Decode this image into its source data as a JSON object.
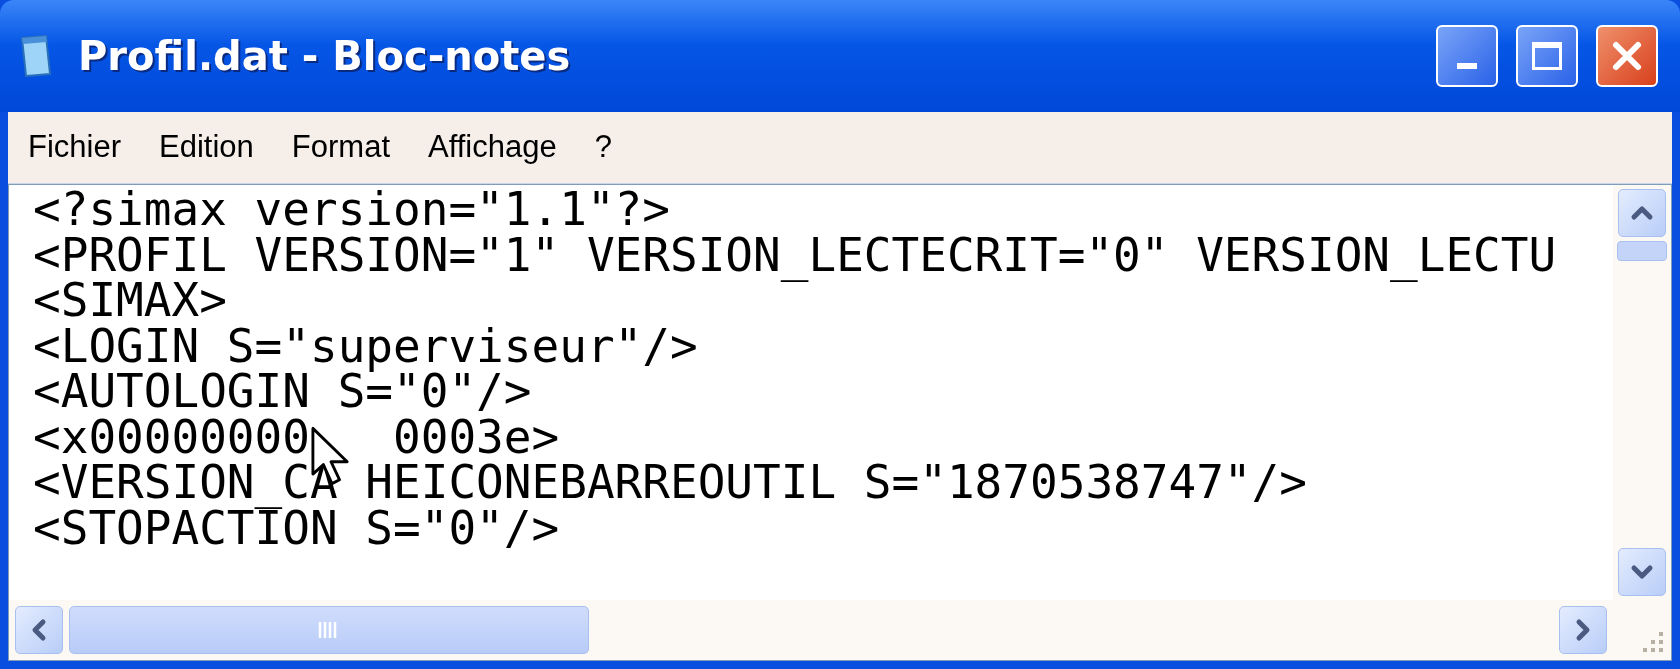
{
  "window": {
    "title": "Profil.dat - Bloc-notes"
  },
  "menu": [
    "Fichier",
    "Edition",
    "Format",
    "Affichage",
    "?"
  ],
  "editor": {
    "lines": [
      "<?simax version=\"1.1\"?>",
      "<PROFIL VERSION=\"1\" VERSION_LECTECRIT=\"0\" VERSION_LECTU",
      "<SIMAX>",
      "<LOGIN S=\"superviseur\"/>",
      "<AUTOLOGIN S=\"0\"/>",
      [
        "<x00000000",
        "0003e>"
      ],
      [
        "<VERSION_CA",
        "HEICONEBARREOUTIL S=\"1870538747\"/>"
      ],
      "<STOPACTION S=\"0\"/>"
    ]
  }
}
